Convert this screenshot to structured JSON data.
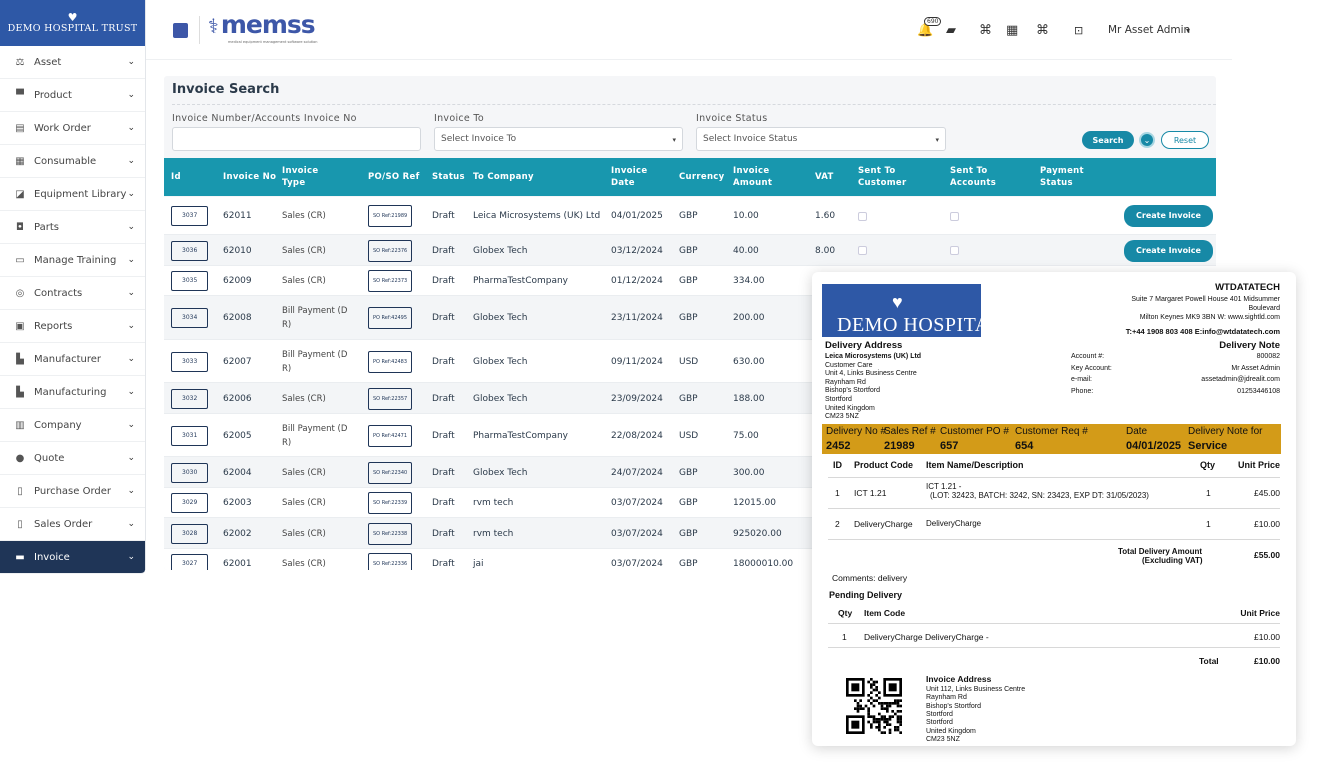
{
  "sidebar": {
    "logo_text": "DEMO HOSPITAL TRUST",
    "items": [
      {
        "label": "Asset",
        "icon": "asset-icon"
      },
      {
        "label": "Product",
        "icon": "product-icon"
      },
      {
        "label": "Work Order",
        "icon": "work-order-icon"
      },
      {
        "label": "Consumable",
        "icon": "consumable-icon"
      },
      {
        "label": "Equipment Library",
        "icon": "equipment-library-icon"
      },
      {
        "label": "Parts",
        "icon": "parts-icon"
      },
      {
        "label": "Manage Training",
        "icon": "training-icon"
      },
      {
        "label": "Contracts",
        "icon": "contracts-icon"
      },
      {
        "label": "Reports",
        "icon": "reports-icon"
      },
      {
        "label": "Manufacturer",
        "icon": "manufacturer-icon"
      },
      {
        "label": "Manufacturing",
        "icon": "manufacturing-icon"
      },
      {
        "label": "Company",
        "icon": "company-icon"
      },
      {
        "label": "Quote",
        "icon": "quote-icon"
      },
      {
        "label": "Purchase Order",
        "icon": "purchase-order-icon"
      },
      {
        "label": "Sales Order",
        "icon": "sales-order-icon"
      },
      {
        "label": "Invoice",
        "icon": "invoice-icon",
        "active": true
      }
    ]
  },
  "header": {
    "app_name": "memss",
    "tagline": "medical equipment management software solution",
    "notification_count": "690",
    "user_name": "Mr Asset Admin"
  },
  "search": {
    "title": "Invoice Search",
    "invoice_no_label": "Invoice Number/Accounts Invoice No",
    "invoice_no_value": "",
    "invoice_to_label": "Invoice To",
    "invoice_to_value": "Select Invoice To",
    "status_label": "Invoice Status",
    "status_value": "Select Invoice Status",
    "search_label": "Search",
    "reset_label": "Reset"
  },
  "table": {
    "headers": [
      "Id",
      "Invoice No",
      "Invoice Type",
      "PO/SO Ref",
      "Status",
      "To Company",
      "Invoice Date",
      "Currency",
      "Invoice Amount",
      "VAT",
      "Sent To Customer",
      "Sent To Accounts",
      "Payment Status"
    ],
    "create_label": "Create Invoice",
    "rows": [
      {
        "id": "3037",
        "no": "62011",
        "type": "Sales (CR)",
        "ref": "SO Ref:21989",
        "status": "Draft",
        "company": "Leica Microsystems (UK) Ltd",
        "date": "04/01/2025",
        "currency": "GBP",
        "amount": "10.00",
        "vat": "1.60",
        "create": true
      },
      {
        "id": "3036",
        "no": "62010",
        "type": "Sales (CR)",
        "ref": "SO Ref:22376",
        "status": "Draft",
        "company": "Globex Tech",
        "date": "03/12/2024",
        "currency": "GBP",
        "amount": "40.00",
        "vat": "8.00",
        "create": true
      },
      {
        "id": "3035",
        "no": "62009",
        "type": "Sales (CR)",
        "ref": "SO Ref:22373",
        "status": "Draft",
        "company": "PharmaTestCompany",
        "date": "01/12/2024",
        "currency": "GBP",
        "amount": "334.00",
        "vat": ""
      },
      {
        "id": "3034",
        "no": "62008",
        "type": "Bill Payment (D R)",
        "ref": "PO Ref:42495",
        "status": "Draft",
        "company": "Globex Tech",
        "date": "23/11/2024",
        "currency": "GBP",
        "amount": "200.00",
        "vat": ""
      },
      {
        "id": "3033",
        "no": "62007",
        "type": "Bill Payment (D R)",
        "ref": "PO Ref:42483",
        "status": "Draft",
        "company": "Globex Tech",
        "date": "09/11/2024",
        "currency": "USD",
        "amount": "630.00",
        "vat": ""
      },
      {
        "id": "3032",
        "no": "62006",
        "type": "Sales (CR)",
        "ref": "SO Ref:22357",
        "status": "Draft",
        "company": "Globex Tech",
        "date": "23/09/2024",
        "currency": "GBP",
        "amount": "188.00",
        "vat": ""
      },
      {
        "id": "3031",
        "no": "62005",
        "type": "Bill Payment (D R)",
        "ref": "PO Ref:42471",
        "status": "Draft",
        "company": "PharmaTestCompany",
        "date": "22/08/2024",
        "currency": "USD",
        "amount": "75.00",
        "vat": ""
      },
      {
        "id": "3030",
        "no": "62004",
        "type": "Sales (CR)",
        "ref": "SO Ref:22340",
        "status": "Draft",
        "company": "Globex Tech",
        "date": "24/07/2024",
        "currency": "GBP",
        "amount": "300.00",
        "vat": ""
      },
      {
        "id": "3029",
        "no": "62003",
        "type": "Sales (CR)",
        "ref": "SO Ref:22339",
        "status": "Draft",
        "company": "rvm tech",
        "date": "03/07/2024",
        "currency": "GBP",
        "amount": "12015.00",
        "vat": ""
      },
      {
        "id": "3028",
        "no": "62002",
        "type": "Sales (CR)",
        "ref": "SO Ref:22338",
        "status": "Draft",
        "company": "rvm tech",
        "date": "03/07/2024",
        "currency": "GBP",
        "amount": "925020.00",
        "vat": ""
      },
      {
        "id": "3027",
        "no": "62001",
        "type": "Sales (CR)",
        "ref": "SO Ref:22336",
        "status": "Draft",
        "company": "jai",
        "date": "03/07/2024",
        "currency": "GBP",
        "amount": "18000010.00",
        "vat": ""
      }
    ]
  },
  "delivery_note": {
    "logo_text": "DEMO HOSPITA",
    "company": "WTDATATECH",
    "addr1": "Suite 7 Margaret Powell House 401 Midsummer",
    "addr2": "Boulevard",
    "addr3": "Milton Keynes MK9 3BN  W: www.sightld.com",
    "contact": "T:+44 1908 803 408  E:info@wtdatatech.com",
    "title": "Delivery Note",
    "delivery_address_label": "Delivery Address",
    "delivery_address": [
      "Leica Microsystems (UK) Ltd",
      "Customer Care",
      "Unit 4, Links Business Centre",
      "Raynham Rd",
      "Bishop's Stortford",
      "Stortford",
      "United Kingdom",
      "CM23 5NZ"
    ],
    "meta_labels": [
      "Account #:",
      "Key Account:",
      "e-mail:",
      "Phone:"
    ],
    "meta_values": [
      "800082",
      "Mr Asset Admin",
      "assetadmin@jdrealit.com",
      "01253446108"
    ],
    "band_labels": [
      "Delivery No #",
      "Sales Ref #",
      "Customer PO #",
      "Customer Req #",
      "Date",
      "Delivery Note for"
    ],
    "band_values": [
      "2452",
      "21989",
      "657",
      "654",
      "04/01/2025",
      "Service"
    ],
    "item_headers": [
      "ID",
      "Product Code",
      "Item Name/Description",
      "Qty",
      "Unit Price"
    ],
    "items": [
      {
        "id": "1",
        "code": "ICT 1.21",
        "desc1": "ICT 1.21 -",
        "desc2": "(LOT: 32423, BATCH: 3242, SN: 23423, EXP DT: 31/05/2023)",
        "qty": "1",
        "price": "£45.00"
      },
      {
        "id": "2",
        "code": "DeliveryCharge",
        "desc1": "DeliveryCharge",
        "desc2": "",
        "qty": "1",
        "price": "£10.00"
      }
    ],
    "total_label1": "Total Delivery Amount",
    "total_label2": "(Excluding VAT)",
    "total_value": "£55.00",
    "comments_label": "Comments:",
    "comments_value": "delivery",
    "pending_label": "Pending Delivery",
    "pending_headers": [
      "Qty",
      "Item Code",
      "Unit Price"
    ],
    "pending_qty": "1",
    "pending_item": "DeliveryCharge DeliveryCharge -",
    "pending_price": "£10.00",
    "pending_total_label": "Total",
    "pending_total_value": "£10.00",
    "invoice_address_label": "Invoice Address",
    "invoice_address": [
      "Unit 112, Links Business Centre",
      "Raynham Rd",
      "Bishop's Stortford",
      "Stortford",
      "Stortford",
      "United Kingdom",
      "CM23 5NZ"
    ]
  }
}
